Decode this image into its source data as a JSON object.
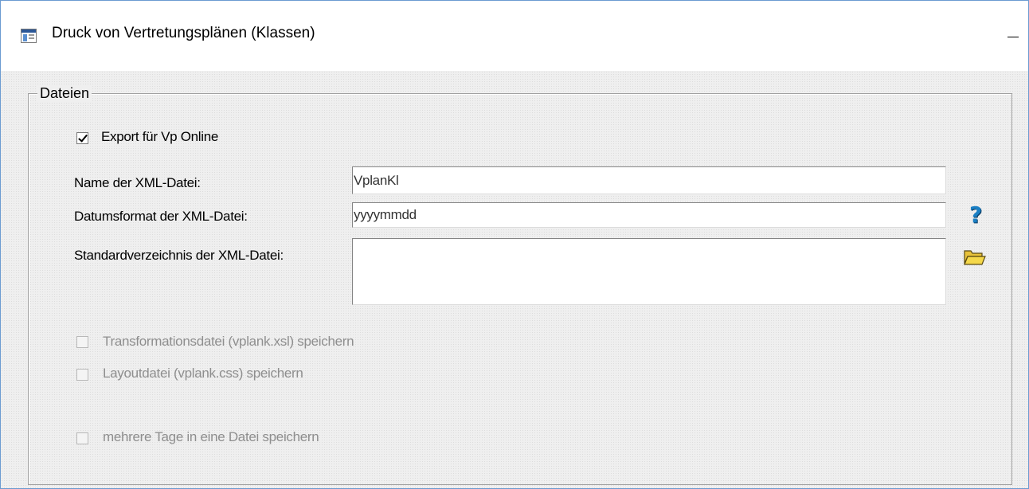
{
  "window": {
    "title": "Druck von Vertretungsplänen (Klassen)",
    "minimize_glyph": "—"
  },
  "group": {
    "label": "Dateien"
  },
  "export": {
    "label": "Export für Vp Online",
    "checked": true
  },
  "fields": {
    "xml_name_label": "Name der XML-Datei:",
    "xml_name_value": "VplanKl",
    "date_format_label": "Datumsformat der XML-Datei:",
    "date_format_value": "yyyymmdd",
    "std_dir_label": "Standardverzeichnis der XML-Datei:",
    "std_dir_value": ""
  },
  "options": {
    "transform_label": "Transformationsdatei (vplank.xsl) speichern",
    "layout_label": "Layoutdatei (vplank.css) speichern",
    "multi_day_label": "mehrere Tage in eine Datei speichern"
  },
  "icons": {
    "help": "help-icon",
    "folder": "folder-open-icon",
    "help_glyph": "?"
  },
  "colors": {
    "help_blue": "#1a7fc4",
    "folder_yellow": "#f5d84a",
    "disabled_text": "#8e8e8e"
  }
}
